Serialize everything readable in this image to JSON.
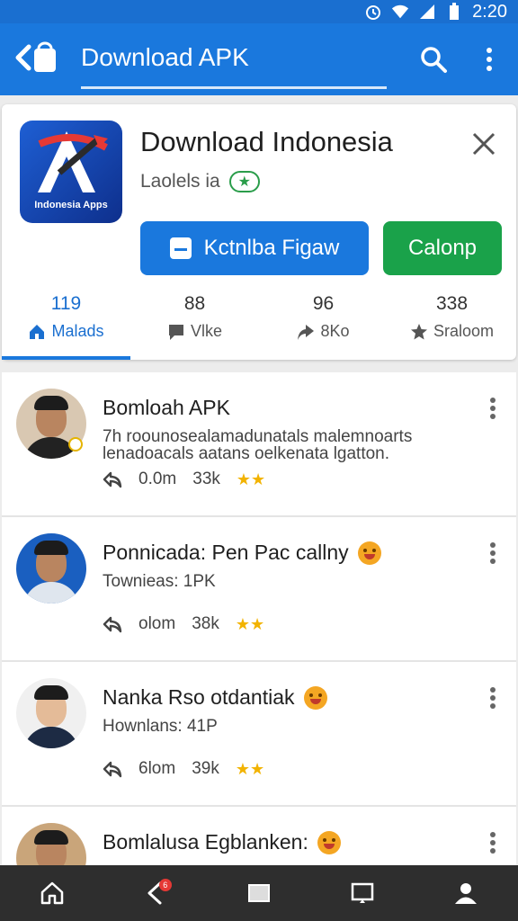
{
  "status_bar": {
    "time": "2:20",
    "icons": [
      "alarm-icon",
      "wifi-icon",
      "signal-icon",
      "battery-icon"
    ]
  },
  "app_bar": {
    "title": "Download APK",
    "icons": [
      "back-icon",
      "search-icon",
      "more-vert-icon"
    ]
  },
  "app_card": {
    "icon_text": "Indonesia Apps",
    "name": "Download Indonesia",
    "publisher": "Laolels ia",
    "verified_icon": "verified-icon",
    "primary_button": "Kctnlba Figaw",
    "secondary_button": "Calonp",
    "stats": [
      {
        "value": "119",
        "label": "Malads",
        "icon": "home-icon",
        "active": true
      },
      {
        "value": "88",
        "label": "Vlke",
        "icon": "comment-icon",
        "active": false
      },
      {
        "value": "96",
        "label": "8Ko",
        "icon": "share-icon",
        "active": false
      },
      {
        "value": "338",
        "label": "Sraloom",
        "icon": "star-icon",
        "active": false
      }
    ]
  },
  "feed": [
    {
      "title": "Bomloah APK",
      "subtitle": "7h roounosealamadunatals malemnoarts lenadoacals aatans oelkenata lgatton.",
      "views": "0.0m",
      "likes": "33k",
      "has_emoji": false
    },
    {
      "title": "Ponnicada: Pen Pac callny",
      "subtitle": "Townieas: 1PK",
      "views": "olom",
      "likes": "38k",
      "has_emoji": true
    },
    {
      "title": "Nanka Rso otdantiak",
      "subtitle": "Hownlans: 41P",
      "views": "6lom",
      "likes": "39k",
      "has_emoji": true
    },
    {
      "title": "Bomlalusa Egblanken:",
      "subtitle": "",
      "views": "",
      "likes": "",
      "has_emoji": true
    }
  ],
  "nav_bar": {
    "items": [
      "home-icon",
      "back-icon",
      "recents-icon",
      "cast-icon",
      "account-icon"
    ],
    "back_badge": "6"
  },
  "colors": {
    "primary": "#1a78dd",
    "secondary": "#1aa24a",
    "nav": "#2e2e2e",
    "star": "#f2b300"
  }
}
